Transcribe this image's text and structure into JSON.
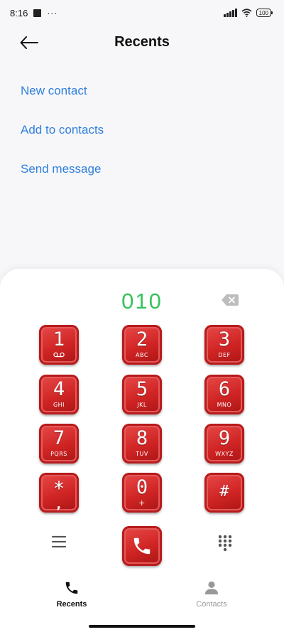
{
  "status_bar": {
    "time": "8:16",
    "dots": "···",
    "battery": "100",
    "icons": [
      "notification-square-icon",
      "signal-icon",
      "wifi-icon",
      "battery-icon"
    ]
  },
  "header": {
    "title": "Recents",
    "back_icon": "arrow-left-icon"
  },
  "options": [
    {
      "label": "New contact"
    },
    {
      "label": "Add to contacts"
    },
    {
      "label": "Send message"
    }
  ],
  "dialer": {
    "number": "010",
    "backspace_icon": "backspace-icon",
    "keys": [
      {
        "digit": "1",
        "letters": "voicemail-icon"
      },
      {
        "digit": "2",
        "letters": "ABC"
      },
      {
        "digit": "3",
        "letters": "DEF"
      },
      {
        "digit": "4",
        "letters": "GHI"
      },
      {
        "digit": "5",
        "letters": "JKL"
      },
      {
        "digit": "6",
        "letters": "MNO"
      },
      {
        "digit": "7",
        "letters": "PQRS"
      },
      {
        "digit": "8",
        "letters": "TUV"
      },
      {
        "digit": "9",
        "letters": "WXYZ"
      },
      {
        "digit": "*",
        "letters": ","
      },
      {
        "digit": "0",
        "letters": "+"
      },
      {
        "digit": "#",
        "letters": ""
      }
    ],
    "menu_icon": "hamburger-menu-icon",
    "call_icon": "phone-icon",
    "dialpad_icon": "dialpad-grid-icon"
  },
  "nav": {
    "recents": "Recents",
    "contacts": "Contacts"
  },
  "colors": {
    "accent_blue": "#2f7fdd",
    "number_green": "#35c35b",
    "key_red": "#d02424"
  }
}
